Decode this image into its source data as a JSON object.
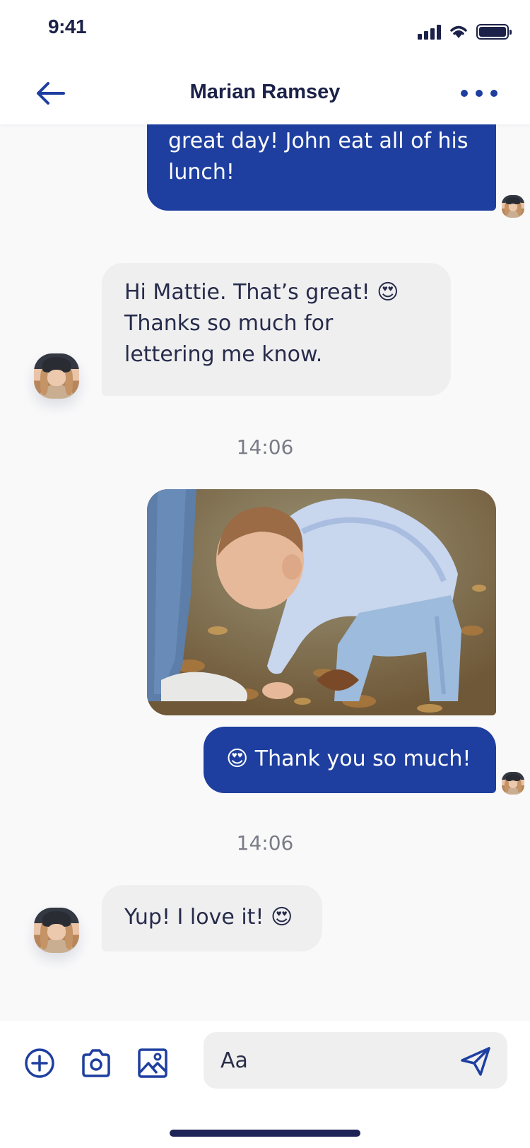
{
  "status_bar": {
    "time": "9:41"
  },
  "header": {
    "title": "Marian Ramsey"
  },
  "messages": {
    "msg1_text": "great day! John eat all of his lunch!",
    "msg2_text": "Hi Mattie. That’s great! 😍 Thanks so much for lettering me know.",
    "time1": "14:06",
    "msg3_text": "😍 Thank you so much!",
    "time2": "14:06",
    "msg4_text": "Yup! I love it! 😍"
  },
  "composer": {
    "placeholder": "Aa"
  },
  "colors": {
    "accent": "#1e3f9f",
    "text_dark": "#1b2148",
    "incoming_bubble": "#efeff0",
    "background": "#f9f9fa"
  },
  "icons": [
    "back-arrow-icon",
    "more-icon",
    "add-icon",
    "camera-icon",
    "image-icon",
    "send-icon"
  ]
}
